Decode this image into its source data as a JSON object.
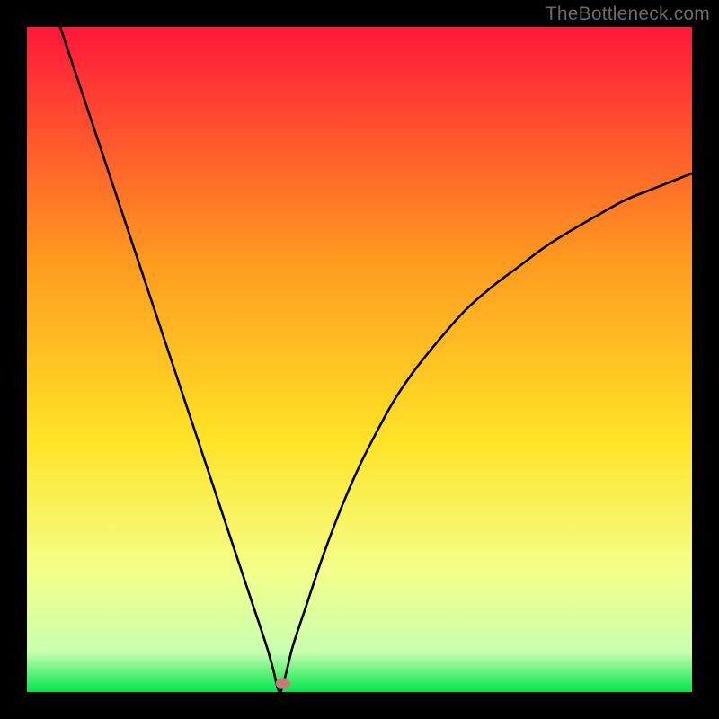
{
  "watermark": "TheBottleneck.com",
  "chart_data": {
    "type": "line",
    "title": "",
    "xlabel": "",
    "ylabel": "",
    "xlim": [
      0,
      100
    ],
    "ylim": [
      0,
      100
    ],
    "gradient_colors": {
      "top": "#ff173a",
      "upper_mid": "#ff9a1f",
      "mid": "#ffe326",
      "lower_mid": "#f3ff8a",
      "approach": "#c8ffb0",
      "bottom": "#00e64d"
    },
    "curve": {
      "description": "V-shaped bottleneck curve with a single minimum near x≈38, y≈0; left branch reaches y=100 at x≈5; right branch rises asymptotically toward y≈78 at x=100.",
      "x": [
        5,
        6,
        8,
        10,
        12,
        14,
        16,
        18,
        20,
        22,
        24,
        26,
        28,
        30,
        32,
        34,
        36,
        37,
        38,
        39,
        40,
        42,
        44,
        46,
        48,
        50,
        52,
        55,
        58,
        62,
        66,
        70,
        74,
        78,
        82,
        86,
        90,
        95,
        100
      ],
      "y": [
        100,
        97,
        91,
        85,
        79,
        73,
        67,
        61,
        55,
        49,
        43,
        37,
        31,
        25,
        19,
        13,
        7,
        3.5,
        0,
        3,
        7,
        13,
        19,
        24.5,
        29.5,
        34,
        38,
        43.5,
        48,
        53,
        57.5,
        61,
        64,
        67,
        69.5,
        71.8,
        74,
        76,
        78
      ]
    },
    "marker": {
      "x": 38.5,
      "y": 1.3,
      "rx": 1.1,
      "ry": 0.85,
      "color": "#c77c76"
    }
  }
}
